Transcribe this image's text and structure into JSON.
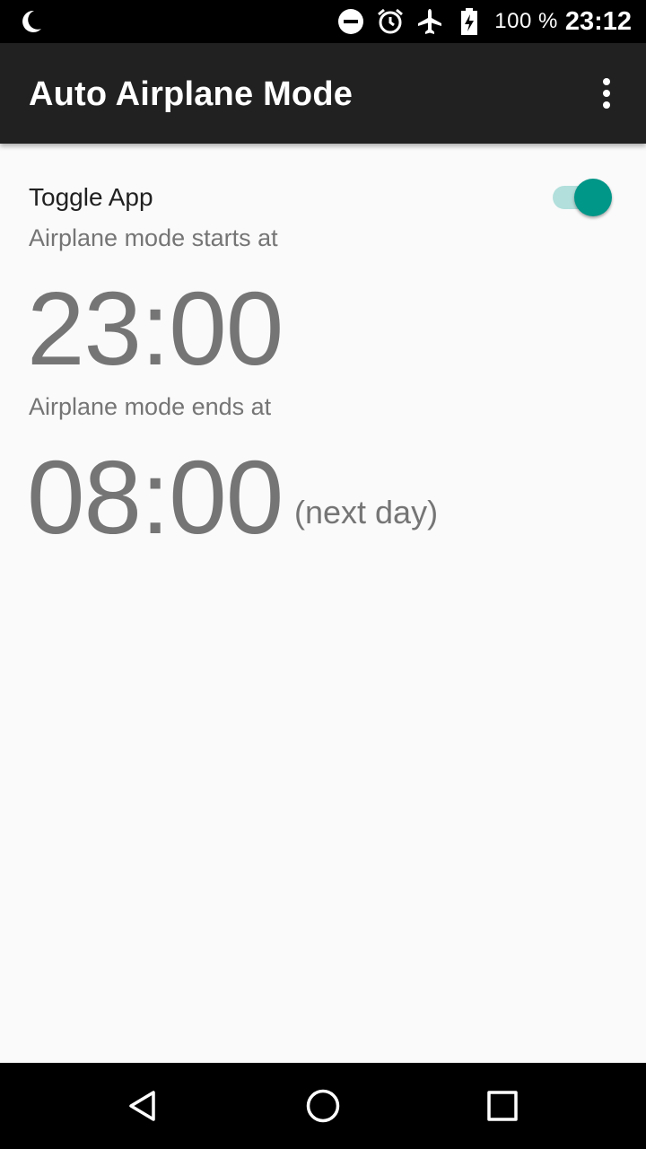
{
  "status_bar": {
    "icons": [
      "moon-icon",
      "do-not-disturb-icon",
      "alarm-icon",
      "airplane-icon",
      "battery-charging-icon"
    ],
    "battery_percent": "100 %",
    "clock": "23:12"
  },
  "app_bar": {
    "title": "Auto Airplane Mode",
    "overflow_icon": "more-vert-icon"
  },
  "settings": {
    "toggle_label": "Toggle App",
    "toggle_on": true,
    "start_caption": "Airplane mode starts at",
    "start_time": "23:00",
    "end_caption": "Airplane mode ends at",
    "end_time": "08:00",
    "end_suffix": "(next day)"
  },
  "nav_bar": {
    "icons": [
      "back-icon",
      "home-icon",
      "recents-icon"
    ]
  },
  "colors": {
    "accent": "#009688",
    "accent_track": "#b2dfdb",
    "app_bar": "#212121",
    "text_secondary": "#757575"
  }
}
